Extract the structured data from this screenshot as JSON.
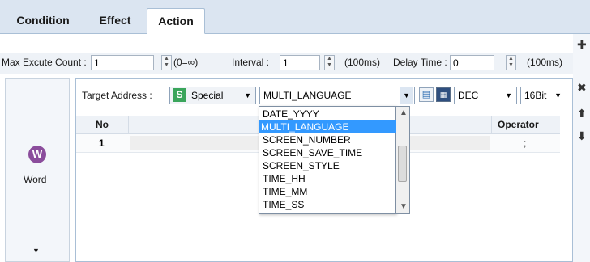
{
  "tabs": [
    {
      "label": "Condition"
    },
    {
      "label": "Effect"
    },
    {
      "label": "Action"
    }
  ],
  "settings": {
    "max_count_label": "Max Excute Count :",
    "max_count_value": "1",
    "infinity_note": "(0=∞)",
    "interval_label": "Interval :",
    "interval_value": "1",
    "interval_unit": "(100ms)",
    "delay_label": "Delay Time :",
    "delay_value": "0",
    "delay_unit": "(100ms)"
  },
  "left_panel": {
    "word_icon": "W",
    "word_label": "Word"
  },
  "target": {
    "label": "Target Address :",
    "type_badge": "S",
    "type_value": "Special",
    "address_value": "MULTI_LANGUAGE",
    "format_value": "DEC",
    "bits_value": "16Bit"
  },
  "table": {
    "columns": {
      "no": "No",
      "operator": "Operator"
    },
    "rows": [
      {
        "no": "1",
        "operator": ";"
      }
    ]
  },
  "dropdown": {
    "options": [
      "DATE_YYYY",
      "MULTI_LANGUAGE",
      "SCREEN_NUMBER",
      "SCREEN_SAVE_TIME",
      "SCREEN_STYLE",
      "TIME_HH",
      "TIME_MM",
      "TIME_SS"
    ],
    "selected": "MULTI_LANGUAGE"
  },
  "toolbar_right": {
    "add_icon": "plus-icon",
    "delete_icon": "close-icon",
    "up_icon": "arrow-up-icon",
    "down_icon": "arrow-down-icon"
  }
}
